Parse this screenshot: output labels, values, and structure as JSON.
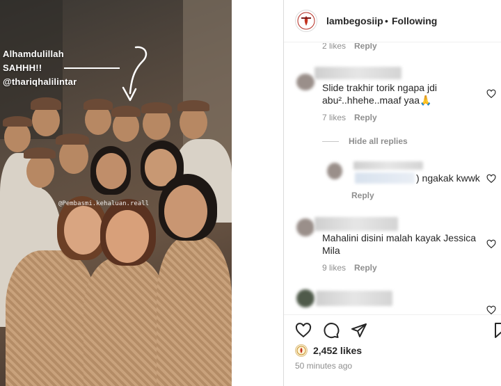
{
  "media": {
    "story_lines": [
      "Alhamdulillah",
      "SAHHH!!",
      "@thariqhalilintar"
    ],
    "credit_tag": "@Pembasmi.kehaluan.reall"
  },
  "header": {
    "username": "lambegosiip",
    "separator": "•",
    "follow_status": "Following"
  },
  "comments": {
    "top_meta": {
      "likes": "2 likes",
      "reply": "Reply"
    },
    "items": [
      {
        "text": "Slide trakhir torik ngapa jdi abu²..hhehe..maaf yaa🙏",
        "likes": "7 likes",
        "reply": "Reply"
      },
      {
        "text": "Mahalini disini malah kayak Jessica Mila",
        "likes": "9 likes",
        "reply": "Reply"
      }
    ],
    "hide_replies": "Hide all replies",
    "nested_reply": {
      "text": ") ngakak kwwk",
      "reply": "Reply"
    }
  },
  "footer": {
    "likes": "2,452 likes",
    "time_ago": "50 minutes ago"
  },
  "icons": {
    "like": "heart-icon",
    "comment": "comment-icon",
    "share": "share-icon",
    "save": "bookmark-icon"
  },
  "colors": {
    "text": "#262626",
    "muted": "#8e8e8e",
    "border": "#dbdbdb"
  }
}
